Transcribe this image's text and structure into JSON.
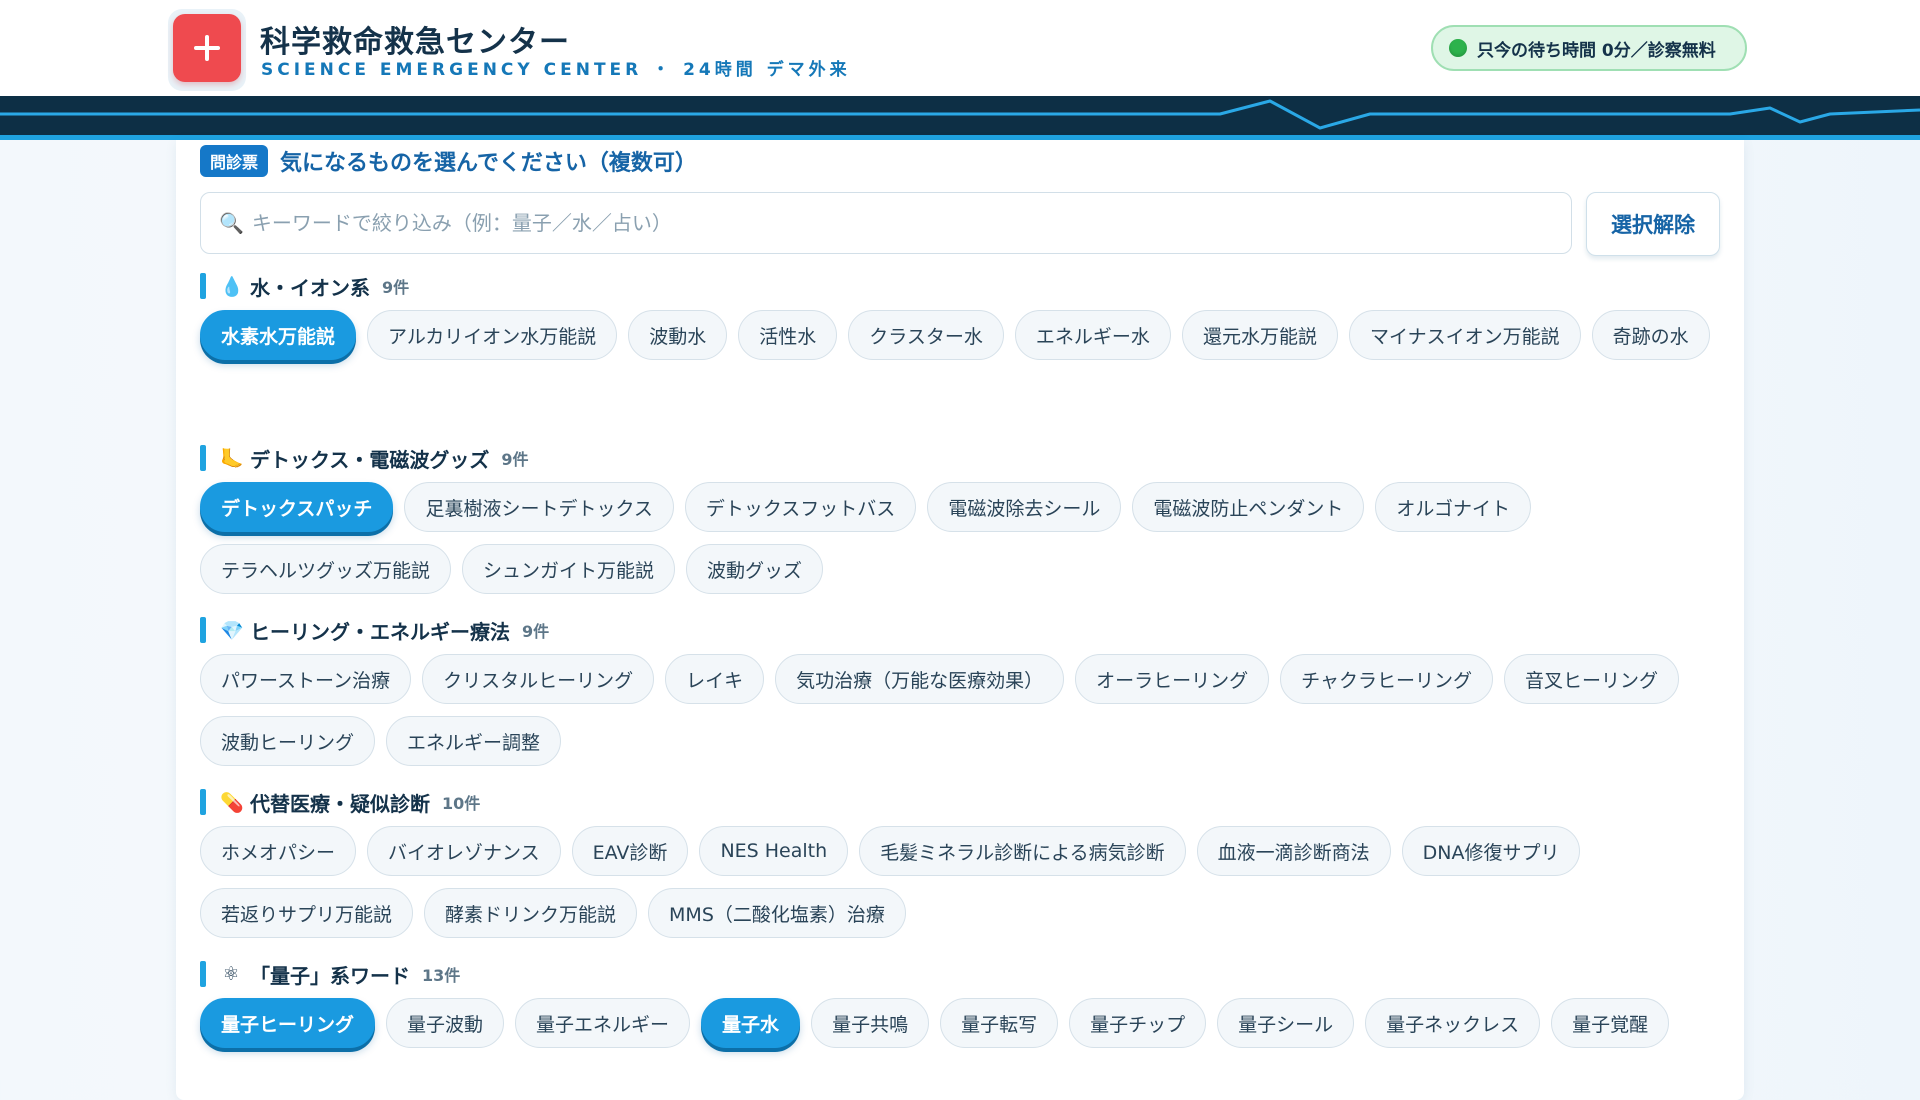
{
  "header": {
    "title": "科学救命救急センター",
    "subtitle": "SCIENCE EMERGENCY CENTER ・ 24時間 デマ外来",
    "wait_status": "只今の待ち時間 0分／診察無料"
  },
  "form": {
    "tag": "問診票",
    "title": "気になるものを選んでください（複数可）",
    "search_placeholder": "キーワードで絞り込み（例：量子／水／占い）",
    "search_value": "",
    "clear_button": "選択解除"
  },
  "sections": [
    {
      "title": "水・イオン系",
      "count": "9件",
      "icon": "droplet-icon",
      "icon_glyph": "💧",
      "items": [
        {
          "label": "水素水万能説",
          "selected": true
        },
        {
          "label": "アルカリイオン水万能説",
          "selected": false
        },
        {
          "label": "波動水",
          "selected": false
        },
        {
          "label": "活性水",
          "selected": false
        },
        {
          "label": "クラスター水",
          "selected": false
        },
        {
          "label": "エネルギー水",
          "selected": false
        },
        {
          "label": "還元水万能説",
          "selected": false
        },
        {
          "label": "マイナスイオン万能説",
          "selected": false
        },
        {
          "label": "奇跡の水",
          "selected": false
        }
      ]
    },
    {
      "title": "デトックス・電磁波グッズ",
      "count": "9件",
      "icon": "foot-icon",
      "icon_glyph": "🦶",
      "items": [
        {
          "label": "デトックスパッチ",
          "selected": true
        },
        {
          "label": "足裏樹液シートデトックス",
          "selected": false
        },
        {
          "label": "デトックスフットバス",
          "selected": false
        },
        {
          "label": "電磁波除去シール",
          "selected": false
        },
        {
          "label": "電磁波防止ペンダント",
          "selected": false
        },
        {
          "label": "オルゴナイト",
          "selected": false
        },
        {
          "label": "テラヘルツグッズ万能説",
          "selected": false
        },
        {
          "label": "シュンガイト万能説",
          "selected": false
        },
        {
          "label": "波動グッズ",
          "selected": false
        }
      ]
    },
    {
      "title": "ヒーリング・エネルギー療法",
      "count": "9件",
      "icon": "gem-icon",
      "icon_glyph": "💎",
      "items": [
        {
          "label": "パワーストーン治療",
          "selected": false
        },
        {
          "label": "クリスタルヒーリング",
          "selected": false
        },
        {
          "label": "レイキ",
          "selected": false
        },
        {
          "label": "気功治療（万能な医療効果）",
          "selected": false
        },
        {
          "label": "オーラヒーリング",
          "selected": false
        },
        {
          "label": "チャクラヒーリング",
          "selected": false
        },
        {
          "label": "音叉ヒーリング",
          "selected": false
        },
        {
          "label": "波動ヒーリング",
          "selected": false
        },
        {
          "label": "エネルギー調整",
          "selected": false
        }
      ]
    },
    {
      "title": "代替医療・疑似診断",
      "count": "10件",
      "icon": "pill-icon",
      "icon_glyph": "💊",
      "items": [
        {
          "label": "ホメオパシー",
          "selected": false
        },
        {
          "label": "バイオレゾナンス",
          "selected": false
        },
        {
          "label": "EAV診断",
          "selected": false
        },
        {
          "label": "NES Health",
          "selected": false
        },
        {
          "label": "毛髪ミネラル診断による病気診断",
          "selected": false
        },
        {
          "label": "血液一滴診断商法",
          "selected": false
        },
        {
          "label": "DNA修復サプリ",
          "selected": false
        },
        {
          "label": "若返りサプリ万能説",
          "selected": false
        },
        {
          "label": "酵素ドリンク万能説",
          "selected": false
        },
        {
          "label": "MMS（二酸化塩素）治療",
          "selected": false
        }
      ]
    },
    {
      "title": "「量子」系ワード",
      "count": "13件",
      "icon": "atom-icon",
      "icon_glyph": "⚛",
      "items": [
        {
          "label": "量子ヒーリング",
          "selected": true
        },
        {
          "label": "量子波動",
          "selected": false
        },
        {
          "label": "量子エネルギー",
          "selected": false
        },
        {
          "label": "量子水",
          "selected": true
        },
        {
          "label": "量子共鳴",
          "selected": false
        },
        {
          "label": "量子転写",
          "selected": false
        },
        {
          "label": "量子チップ",
          "selected": false
        },
        {
          "label": "量子シール",
          "selected": false
        },
        {
          "label": "量子ネックレス",
          "selected": false
        },
        {
          "label": "量子覚醒",
          "selected": false
        }
      ]
    }
  ],
  "colors": {
    "accent": "#1a9ae0",
    "logo_red": "#ef4a4f",
    "header_band": "#0d2f45",
    "wait_green": "#2db24c"
  }
}
